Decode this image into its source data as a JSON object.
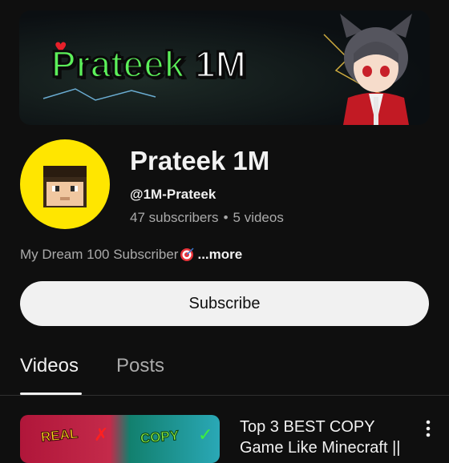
{
  "banner": {
    "title": "Prateek",
    "title_suffix": "1M"
  },
  "channel": {
    "title": "Prateek 1M",
    "handle": "@1M-Prateek",
    "subscribers": "47 subscribers",
    "separator": "•",
    "videos": "5 videos",
    "description": "My Dream 100 Subscriber",
    "more_label": "...more"
  },
  "subscribe": {
    "label": "Subscribe"
  },
  "tabs": [
    {
      "label": "Videos",
      "active": true
    },
    {
      "label": "Posts",
      "active": false
    }
  ],
  "video": {
    "title": "Top 3 BEST COPY Game Like Minecraft ||",
    "thumb_left_text": "REAL",
    "thumb_right_text": "COPY"
  },
  "colors": {
    "background": "#0f0f0f",
    "text_primary": "#f1f1f1",
    "text_secondary": "#aaaaaa",
    "avatar_bg": "#ffe600",
    "banner_green": "#5cf05a",
    "button_bg": "#f1f1f1"
  },
  "icons": {
    "target": "target-emoji-icon",
    "menu": "kebab-menu-icon"
  }
}
